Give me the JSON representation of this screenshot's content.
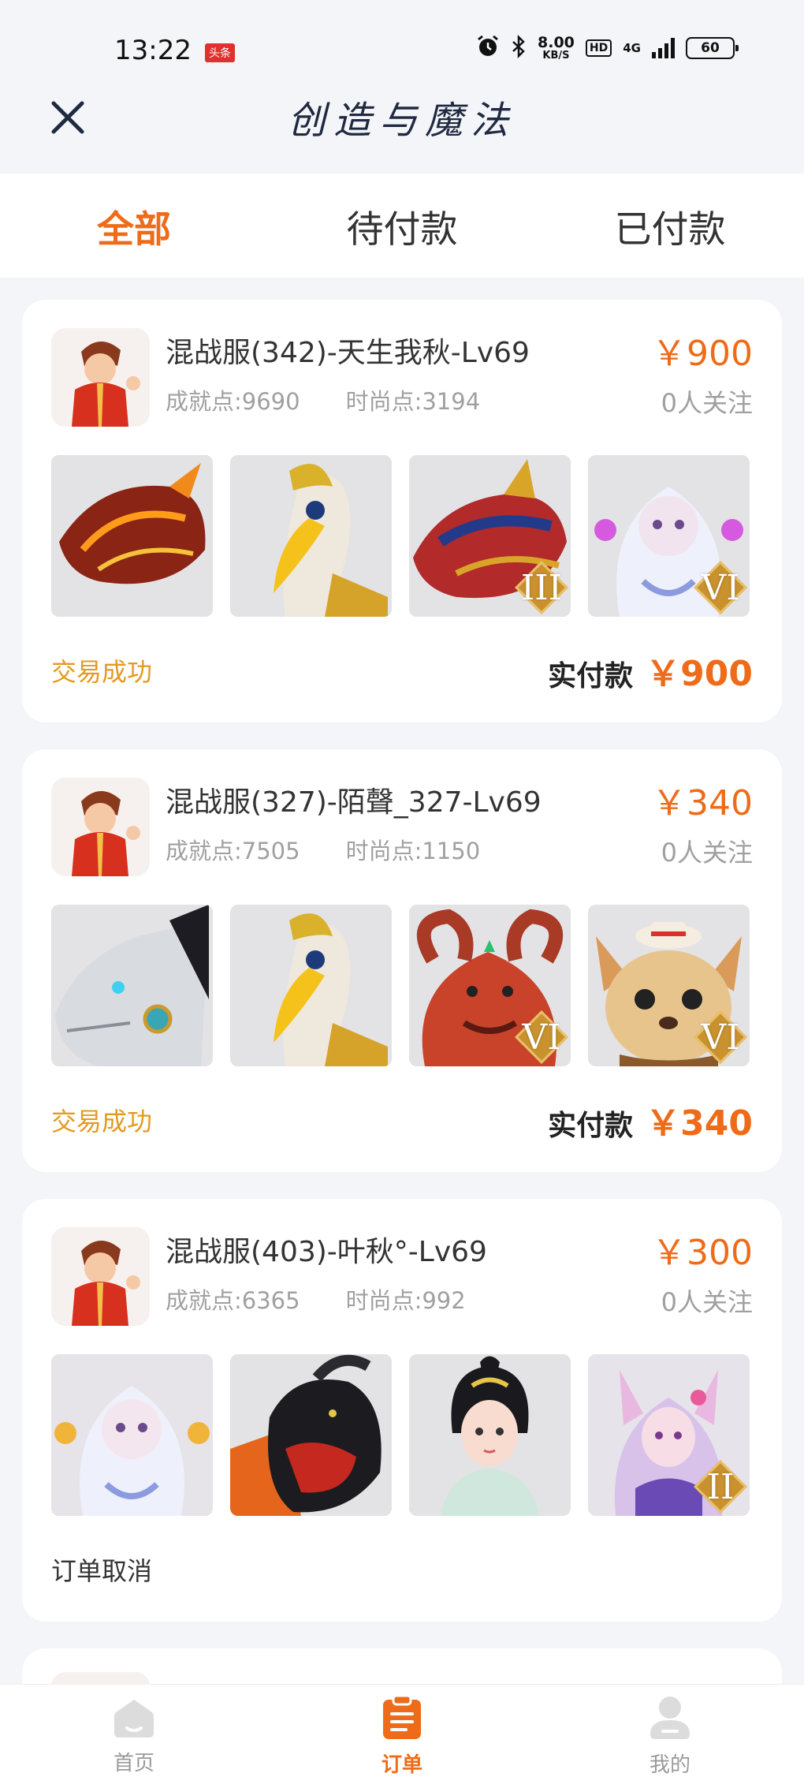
{
  "status_bar": {
    "time": "13:22",
    "badge": "头条",
    "speed_value": "8.00",
    "speed_unit": "KB/S",
    "hd": "HD",
    "network": "4G",
    "battery": "60"
  },
  "header": {
    "title": "创造与魔法",
    "close_icon": "close-icon"
  },
  "tabs": [
    {
      "label": "全部",
      "active": true
    },
    {
      "label": "待付款",
      "active": false
    },
    {
      "label": "已付款",
      "active": false
    }
  ],
  "orders": [
    {
      "name": "混战服(342)-天生我秋-Lv69",
      "achievement": "成就点:9690",
      "fashion": "时尚点:3194",
      "price": "￥900",
      "followers": "0人关注",
      "status": "交易成功",
      "paid_label": "实付款",
      "paid_amount": "￥900",
      "thumbs": [
        {
          "icon": "lava-dragon-mount",
          "tier": ""
        },
        {
          "icon": "hornbill-mount",
          "tier": ""
        },
        {
          "icon": "dragon-mount",
          "tier": "III"
        },
        {
          "icon": "spirit-girl-pet",
          "tier": "VI"
        }
      ]
    },
    {
      "name": "混战服(327)-陌聲_327-Lv69",
      "achievement": "成就点:7505",
      "fashion": "时尚点:1150",
      "price": "￥340",
      "followers": "0人关注",
      "status": "交易成功",
      "paid_label": "实付款",
      "paid_amount": "￥340",
      "thumbs": [
        {
          "icon": "mech-wolf-mount",
          "tier": ""
        },
        {
          "icon": "hornbill-mount",
          "tier": ""
        },
        {
          "icon": "ram-demon-mount",
          "tier": "VI"
        },
        {
          "icon": "hamster-pet",
          "tier": "VI"
        }
      ]
    },
    {
      "name": "混战服(403)-叶秋°-Lv69",
      "achievement": "成就点:6365",
      "fashion": "时尚点:992",
      "price": "￥300",
      "followers": "0人关注",
      "status": "订单取消",
      "thumbs": [
        {
          "icon": "spirit-girl-pet",
          "tier": ""
        },
        {
          "icon": "black-goat-mount",
          "tier": ""
        },
        {
          "icon": "princess-pet",
          "tier": ""
        },
        {
          "icon": "fox-girl-pet",
          "tier": "II"
        }
      ]
    }
  ],
  "bottom_nav": [
    {
      "label": "首页",
      "icon": "home-icon",
      "active": false
    },
    {
      "label": "订单",
      "icon": "order-icon",
      "active": true
    },
    {
      "label": "我的",
      "icon": "profile-icon",
      "active": false
    }
  ],
  "colors": {
    "accent": "#ee6c19",
    "success": "#e39a22",
    "background": "#f3f5f8"
  }
}
